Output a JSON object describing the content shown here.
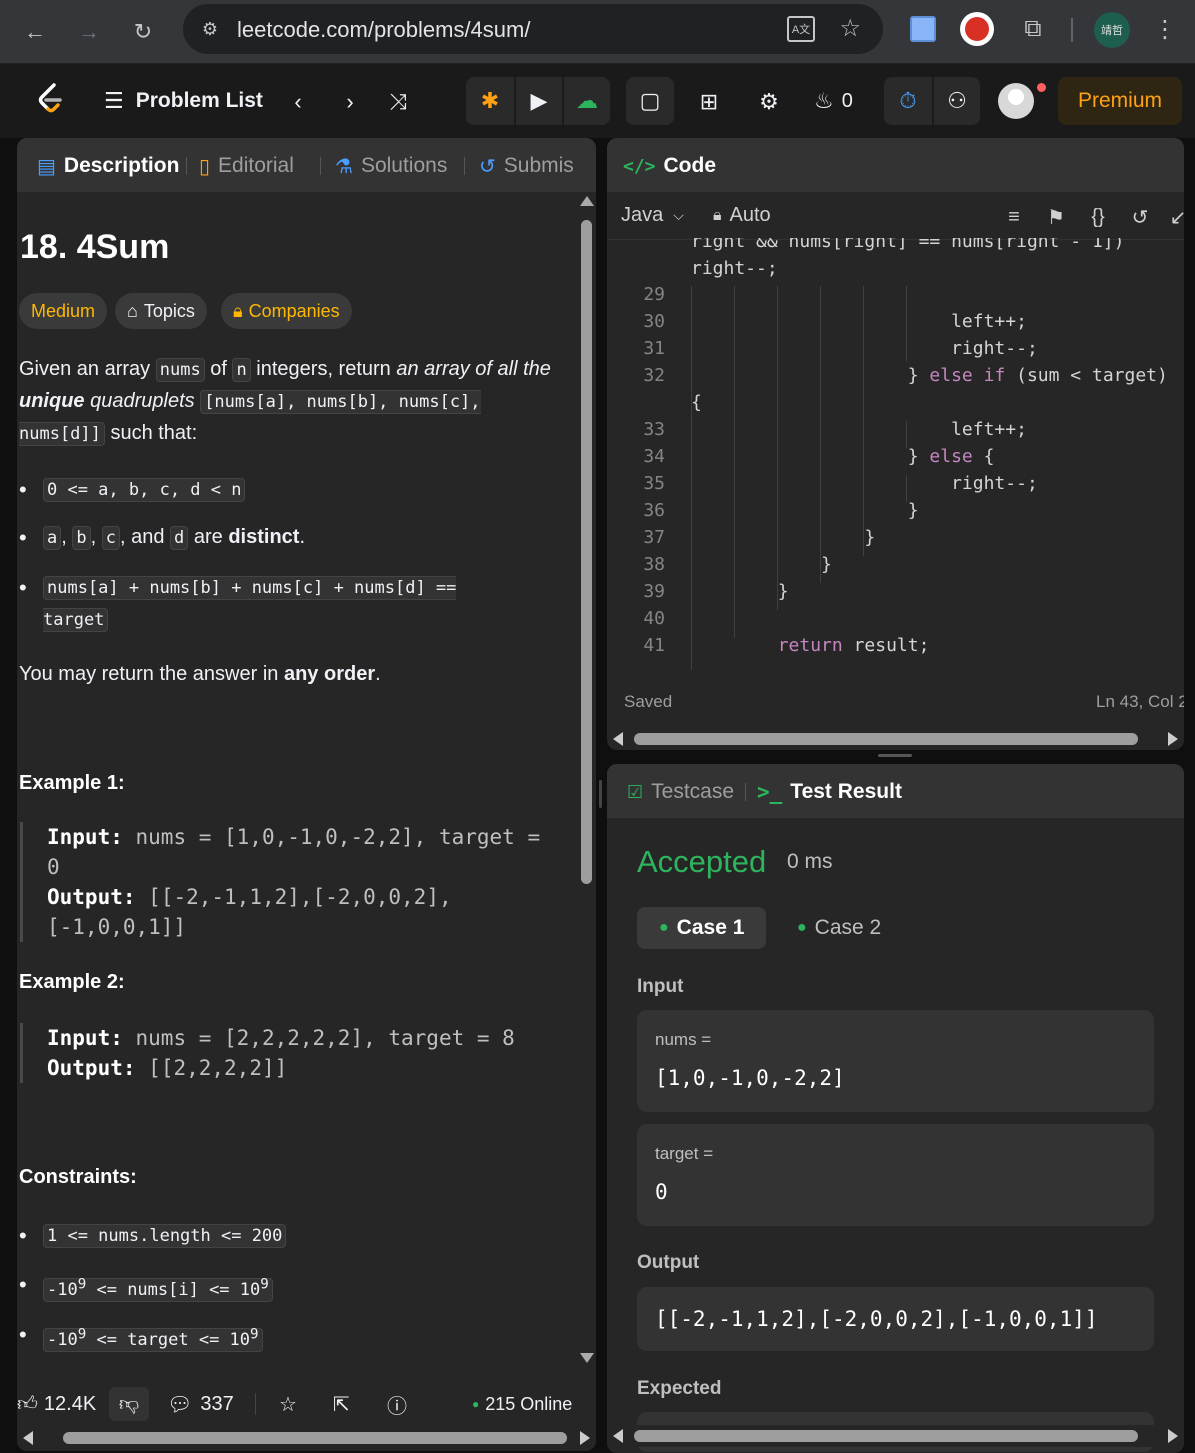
{
  "browser": {
    "url": "leetcode.com/problems/4sum/",
    "profile_label": "靖哲"
  },
  "nav": {
    "problem_list": "Problem List",
    "streak": "0",
    "premium": "Premium"
  },
  "left_tabs": {
    "description": "Description",
    "editorial": "Editorial",
    "solutions": "Solutions",
    "submissions": "Submis"
  },
  "problem": {
    "title": "18. 4Sum",
    "difficulty": "Medium",
    "topics": "Topics",
    "companies": "Companies",
    "intro": {
      "p1": "Given an array ",
      "c1": "nums",
      "p2": " of ",
      "c2": "n",
      "p3": " integers, return ",
      "em1": "an array of all the ",
      "strong1": "unique",
      "em2": " quadruplets",
      "p4": " ",
      "c3": "[nums[a], nums[b], nums[c], nums[d]]",
      "p5": " such that:"
    },
    "bullets": {
      "b1_code": "0 <= a, b, c, d < n",
      "b2_a": "a",
      "b2_b": "b",
      "b2_c": "c",
      "b2_and": ", and ",
      "b2_d": "d",
      "b2_are": " are ",
      "b2_distinct": "distinct",
      "b2_end": ".",
      "b3_code": "nums[a] + nums[b] + nums[c] + nums[d] == target"
    },
    "order": {
      "p1": "You may return the answer in ",
      "strong": "any order",
      "p2": "."
    },
    "examples": [
      {
        "title": "Example 1:",
        "input_label": "Input:",
        "input": "nums = [1,0,-1,0,-2,2], target = 0",
        "output_label": "Output:",
        "output": "[[-2,-1,1,2],[-2,0,0,2],[-1,0,0,1]]"
      },
      {
        "title": "Example 2:",
        "input_label": "Input:",
        "input": "nums = [2,2,2,2,2], target = 8",
        "output_label": "Output:",
        "output": "[[2,2,2,2]]"
      }
    ],
    "constraints_title": "Constraints:",
    "constraints": {
      "c1": "1 <= nums.length <= 200",
      "c2_a": "-10",
      "c2_sup1": "9",
      "c2_b": " <= nums[i] <= 10",
      "c2_sup2": "9",
      "c3_a": "-10",
      "c3_sup1": "9",
      "c3_b": " <= target <= 10",
      "c3_sup2": "9"
    }
  },
  "footer": {
    "likes": "12.4K",
    "comments": "337",
    "online": "215 Online"
  },
  "code_panel": {
    "title": "Code",
    "language": "Java",
    "mode": "Auto",
    "lines": [
      {
        "n": "",
        "t": "right && nums[right] == nums[right - 1])"
      },
      {
        "n": "",
        "t": "right--;"
      },
      {
        "n": "29",
        "t": ""
      },
      {
        "n": "30",
        "t": "                        left++;"
      },
      {
        "n": "31",
        "t": "                        right--;"
      },
      {
        "n": "32",
        "t": "                    } else if (sum < target)"
      },
      {
        "n": "",
        "t": "{"
      },
      {
        "n": "33",
        "t": "                        left++;"
      },
      {
        "n": "34",
        "t": "                    } else {"
      },
      {
        "n": "35",
        "t": "                        right--;"
      },
      {
        "n": "36",
        "t": "                    }"
      },
      {
        "n": "37",
        "t": "                }"
      },
      {
        "n": "38",
        "t": "            }"
      },
      {
        "n": "39",
        "t": "        }"
      },
      {
        "n": "40",
        "t": ""
      },
      {
        "n": "41",
        "t": "        return result;"
      }
    ],
    "status_saved": "Saved",
    "cursor": "Ln 43, Col 2"
  },
  "result_panel": {
    "tab_testcase": "Testcase",
    "tab_result": "Test Result",
    "status": "Accepted",
    "runtime": "0 ms",
    "case1": "Case 1",
    "case2": "Case 2",
    "input_label": "Input",
    "nums_label": "nums =",
    "nums_value": "[1,0,-1,0,-2,2]",
    "target_label": "target =",
    "target_value": "0",
    "output_label": "Output",
    "output_value": "[[-2,-1,1,2],[-2,0,0,2],[-1,0,0,1]]",
    "expected_label": "Expected"
  },
  "colors": {
    "accent_orange": "#ffa116",
    "accepted_green": "#2db55d",
    "keyword_purple": "#c586c0",
    "difficulty_medium": "#ffb800"
  }
}
